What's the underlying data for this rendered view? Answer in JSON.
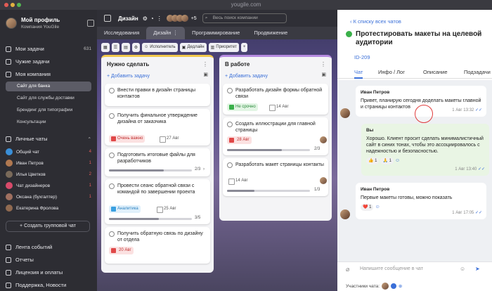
{
  "window": {
    "title": "yougile.com"
  },
  "sidebar": {
    "profile_name": "Мой профиль",
    "company": "Компания YouGile",
    "items": [
      {
        "label": "Мои задачи",
        "count": "631"
      },
      {
        "label": "Чужие задачи",
        "count": ""
      },
      {
        "label": "Моя компания",
        "count": ""
      }
    ],
    "projects": [
      "Сайт для банка",
      "Сайт для службы доставки",
      "Брендинг для типографии",
      "Консультации"
    ],
    "chats_title": "Личные чаты",
    "chats": [
      {
        "name": "Общий чат",
        "count": "4",
        "color": "#3a8fd8"
      },
      {
        "name": "Иван Петров",
        "count": "1",
        "color": "#b07850"
      },
      {
        "name": "Илья Цветков",
        "count": "2",
        "color": "#7a6a5a"
      },
      {
        "name": "Чат дизайнеров",
        "count": "1",
        "color": "#d84a6a"
      },
      {
        "name": "Оксана (бухгалтер)",
        "count": "1",
        "color": "#a07060"
      },
      {
        "name": "Екатерина Фролова",
        "count": "",
        "color": "#906a50"
      }
    ],
    "add_chat": "Создать групповой чат",
    "bottom": [
      "Лента событий",
      "Отчеты",
      "Лицензия и оплаты",
      "Поддержка, Новости"
    ]
  },
  "topbar": {
    "title": "Дизайн",
    "avatars_more": "+5",
    "search_placeholder": "Весь поиск компании"
  },
  "tabs": [
    "Исследования",
    "Дизайн",
    "Программирование",
    "Продвижение"
  ],
  "filters": {
    "assignee": "Исполнитель",
    "deadline": "Дедлайн",
    "priority": "Приоритет"
  },
  "columns": [
    {
      "title": "Нужно сделать",
      "add": "Добавить задачу",
      "cards": [
        {
          "text": "Внести правки в дизайн страницы контактов"
        },
        {
          "text": "Получить финальное утверждение дизайна от заказчика",
          "tag": "Очень важно",
          "tag_color": "#e04848",
          "date": "27 Авг"
        },
        {
          "text": "Подготовить итоговые файлы для разработчиков",
          "progress": "2/3",
          "fill": 0.66
        },
        {
          "text": "Провести сеанс обратной связи с командой по завершении проекта",
          "tag": "Аналитика",
          "tag_color": "#3aa0e0",
          "date": "25 Авг",
          "progress": "3/5",
          "fill": 0.6
        },
        {
          "text": "Получить обратную связь по дизайну от отдела",
          "date": "20 Авг"
        }
      ]
    },
    {
      "title": "В работе",
      "add": "Добавить задачу",
      "cards": [
        {
          "text": "Разработать дизайн формы обратной связи",
          "tag": "Не срочно",
          "tag_color": "#3ab04a",
          "date": "14 Авг"
        },
        {
          "text": "Создать иллюстрации для главной страницы",
          "date": "28 Авг",
          "progress": "2/3",
          "fill": 0.66
        },
        {
          "text": "Разработать макет страницы контакты",
          "date": "14 Авг",
          "progress": "1/3",
          "fill": 0.33
        }
      ]
    }
  ],
  "panel": {
    "back": "К списку всех чатов",
    "title": "Протестировать макеты на целевой аудитории",
    "id": "ID-209",
    "tabs": [
      "Чат",
      "Инфо / Лог",
      "Описание",
      "Подзадачи"
    ],
    "messages": [
      {
        "name": "Иван Петров",
        "text": "Привет, планирую сегодня доделать макеты главной и страницы контактов",
        "time": "1 Авг 13:32"
      },
      {
        "name": "Вы",
        "text": "Хорошо. Клиент просит сделать минималистичный сайт в синих тонах, чтобы это ассоциировалось с надежностью и безопасностью.",
        "time": "1 Авг 13:40",
        "reactions": [
          "👍 1",
          "🙏 1"
        ]
      },
      {
        "name": "Иван Петров",
        "text": "Первые макеты готовы, можно показать",
        "time": "1 Авг 17:05",
        "reactions": [
          "❤️ 1"
        ]
      }
    ],
    "input_placeholder": "Напишите сообщение в чат",
    "participants": "Участники чата:"
  }
}
